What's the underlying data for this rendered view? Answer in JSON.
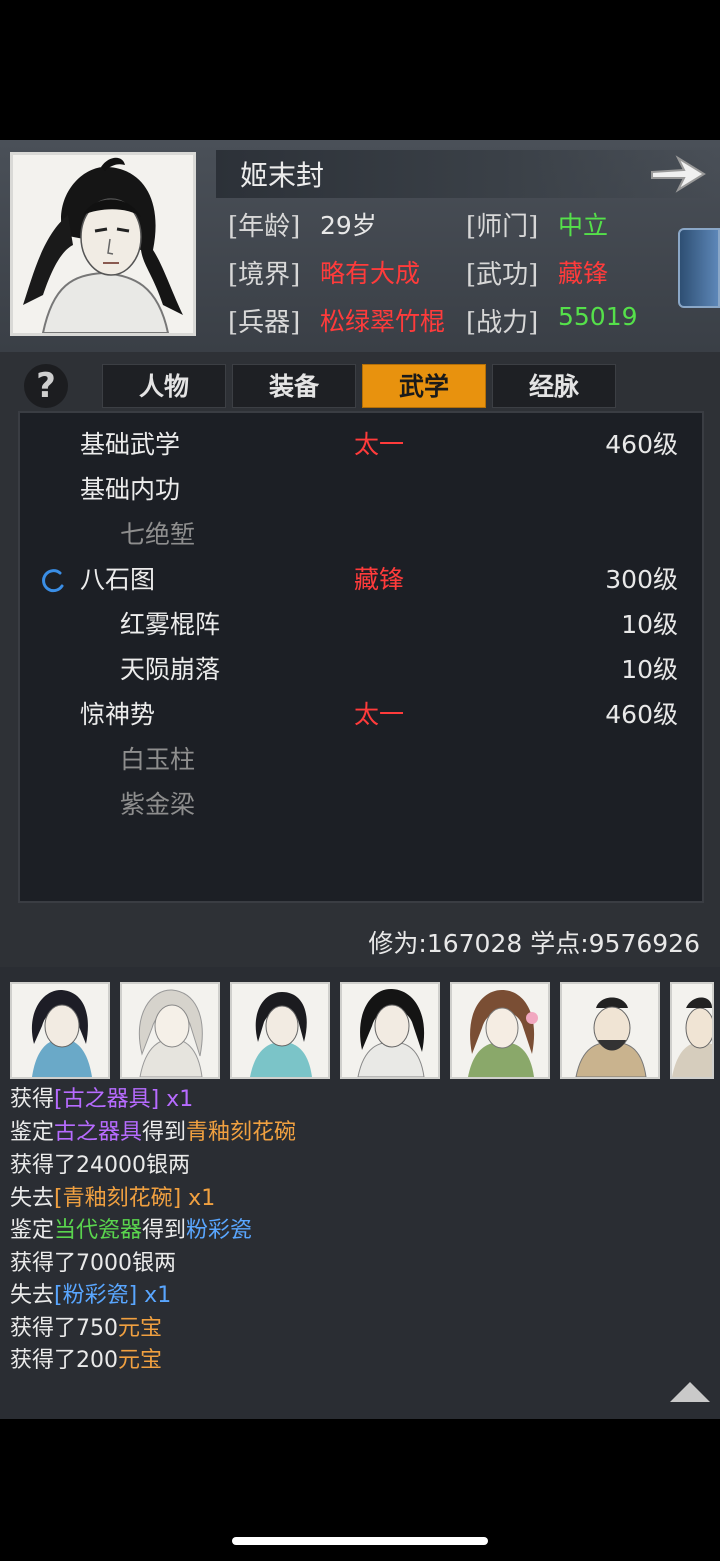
{
  "character": {
    "name": "姬末封",
    "fields": [
      {
        "label": "[年龄]",
        "value": "29岁",
        "color": "#e8e8e8"
      },
      {
        "label": "[师门]",
        "value": "中立",
        "color": "#55e04a"
      },
      {
        "label": "[境界]",
        "value": "略有大成",
        "color": "#ff3b3b"
      },
      {
        "label": "[武功]",
        "value": "藏锋",
        "color": "#ff3b3b"
      },
      {
        "label": "[兵器]",
        "value": "松绿翠竹棍",
        "color": "#ff3b3b"
      },
      {
        "label": "[战力]",
        "value": "55019",
        "color": "#55e04a"
      }
    ]
  },
  "help_label": "?",
  "tabs": [
    {
      "label": "人物",
      "active": false
    },
    {
      "label": "装备",
      "active": false
    },
    {
      "label": "武学",
      "active": true
    },
    {
      "label": "经脉",
      "active": false
    }
  ],
  "skills": [
    {
      "name": "基础武学",
      "tag": "太一",
      "level": "460级",
      "indent": false,
      "dim": false,
      "spinner": false
    },
    {
      "name": "基础内功",
      "tag": "",
      "level": "",
      "indent": false,
      "dim": false,
      "spinner": false
    },
    {
      "name": "七绝堑",
      "tag": "",
      "level": "",
      "indent": true,
      "dim": true,
      "spinner": false
    },
    {
      "name": "八石图",
      "tag": "藏锋",
      "level": "300级",
      "indent": false,
      "dim": false,
      "spinner": true
    },
    {
      "name": "红雾棍阵",
      "tag": "",
      "level": "10级",
      "indent": true,
      "dim": false,
      "spinner": false
    },
    {
      "name": "天陨崩落",
      "tag": "",
      "level": "10级",
      "indent": true,
      "dim": false,
      "spinner": false
    },
    {
      "name": "惊神势",
      "tag": "太一",
      "level": "460级",
      "indent": false,
      "dim": false,
      "spinner": false
    },
    {
      "name": "白玉柱",
      "tag": "",
      "level": "",
      "indent": true,
      "dim": true,
      "spinner": false
    },
    {
      "name": "紫金梁",
      "tag": "",
      "level": "",
      "indent": true,
      "dim": true,
      "spinner": false
    }
  ],
  "stats_text": "修为:167028 学点:9576926",
  "log": [
    [
      {
        "t": "获得",
        "c": ""
      },
      {
        "t": "[古之器具]",
        "c": "purple"
      },
      {
        "t": " x1",
        "c": "purple"
      }
    ],
    [
      {
        "t": "鉴定",
        "c": ""
      },
      {
        "t": "古之器具",
        "c": "purple"
      },
      {
        "t": "得到",
        "c": ""
      },
      {
        "t": "青釉刻花碗",
        "c": "orange"
      }
    ],
    [
      {
        "t": "获得了24000银两",
        "c": ""
      }
    ],
    [
      {
        "t": "失去",
        "c": ""
      },
      {
        "t": "[青釉刻花碗]",
        "c": "orange"
      },
      {
        "t": " x1",
        "c": "orange"
      }
    ],
    [
      {
        "t": "鉴定",
        "c": ""
      },
      {
        "t": "当代瓷器",
        "c": "lgreen"
      },
      {
        "t": "得到",
        "c": ""
      },
      {
        "t": "粉彩瓷",
        "c": "blue"
      }
    ],
    [
      {
        "t": "获得了7000银两",
        "c": ""
      }
    ],
    [
      {
        "t": "失去",
        "c": ""
      },
      {
        "t": "[粉彩瓷]",
        "c": "blue"
      },
      {
        "t": " x1",
        "c": "blue"
      }
    ],
    [
      {
        "t": "获得了750",
        "c": ""
      },
      {
        "t": "元宝",
        "c": "orange"
      }
    ],
    [
      {
        "t": "获得了200",
        "c": ""
      },
      {
        "t": "元宝",
        "c": "orange"
      }
    ]
  ],
  "icons": {
    "next": "right-arrow-icon",
    "scroll_up": "triangle-up-icon",
    "loading": "spinner-icon"
  }
}
